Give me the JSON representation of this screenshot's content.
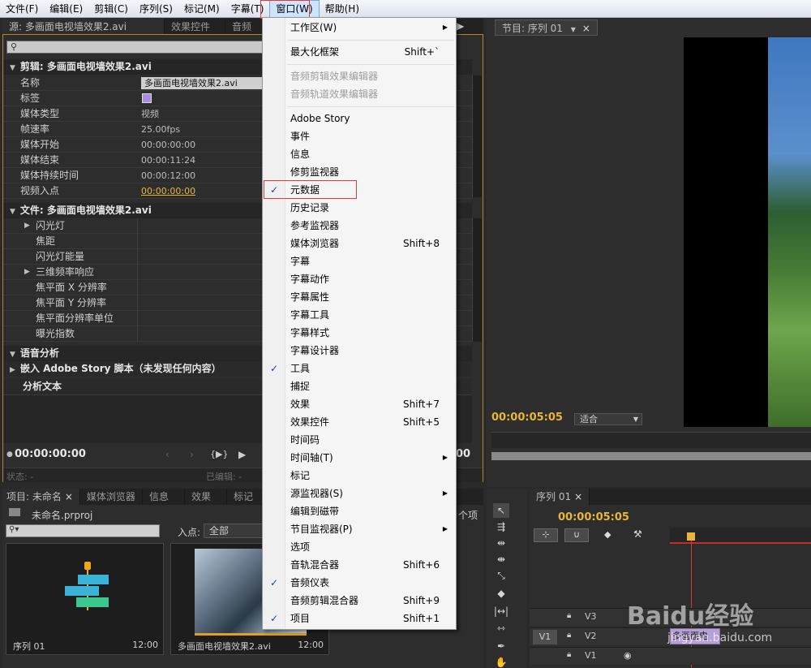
{
  "menubar": {
    "items": [
      "文件(F)",
      "编辑(E)",
      "剪辑(C)",
      "序列(S)",
      "标记(M)",
      "字幕(T)",
      "窗口(W)",
      "帮助(H)"
    ]
  },
  "meta_panel": {
    "tabs": [
      "源: 多画面电视墙效果2.avi",
      "效果控件",
      "音频"
    ],
    "clip_header": "剪辑: 多画面电视墙效果2.avi",
    "clip_rows": [
      {
        "k": "名称",
        "v": "多画面电视墙效果2.avi"
      },
      {
        "k": "标签",
        "v": ""
      },
      {
        "k": "媒体类型",
        "v": "视频"
      },
      {
        "k": "帧速率",
        "v": "25.00fps"
      },
      {
        "k": "媒体开始",
        "v": "00:00:00:00"
      },
      {
        "k": "媒体结束",
        "v": "00:00:11:24"
      },
      {
        "k": "媒体持续时间",
        "v": "00:00:12:00"
      },
      {
        "k": "视频入点",
        "v": "00:00:00:00"
      }
    ],
    "file_header": "文件: 多画面电视墙效果2.avi",
    "file_rows": [
      {
        "k": "闪光灯",
        "expand": true
      },
      {
        "k": "焦距",
        "expand": false
      },
      {
        "k": "闪光灯能量",
        "expand": false
      },
      {
        "k": "三维频率响应",
        "expand": true
      },
      {
        "k": "焦平面 X 分辨率",
        "expand": false
      },
      {
        "k": "焦平面 Y 分辨率",
        "expand": false
      },
      {
        "k": "焦平面分辨率单位",
        "expand": false
      },
      {
        "k": "曝光指数",
        "expand": false
      }
    ],
    "speech_header": "语音分析",
    "embed_label": "嵌入 Adobe Story 脚本（未发现任何内容）",
    "analysis_label": "分析文本",
    "timecode": "00:00:00:00",
    "timecode_right": "00",
    "status_label": "状态: -",
    "edited_label": "已编辑: -"
  },
  "menu": {
    "items": [
      {
        "label": "工作区(W)",
        "sc": "",
        "sub": true,
        "check": false,
        "disabled": false
      },
      {
        "sep": true
      },
      {
        "label": "最大化框架",
        "sc": "Shift+`",
        "sub": false,
        "check": false,
        "disabled": false
      },
      {
        "sep": true
      },
      {
        "label": "音频剪辑效果编辑器",
        "sc": "",
        "sub": false,
        "check": false,
        "disabled": true
      },
      {
        "label": "音频轨道效果编辑器",
        "sc": "",
        "sub": false,
        "check": false,
        "disabled": true
      },
      {
        "sep": true
      },
      {
        "label": "Adobe Story",
        "sc": "",
        "sub": false,
        "check": false,
        "disabled": false
      },
      {
        "label": "事件",
        "sc": "",
        "sub": false,
        "check": false,
        "disabled": false
      },
      {
        "label": "信息",
        "sc": "",
        "sub": false,
        "check": false,
        "disabled": false
      },
      {
        "label": "修剪监视器",
        "sc": "",
        "sub": false,
        "check": false,
        "disabled": false
      },
      {
        "label": "元数据",
        "sc": "",
        "sub": false,
        "check": true,
        "disabled": false
      },
      {
        "label": "历史记录",
        "sc": "",
        "sub": false,
        "check": false,
        "disabled": false
      },
      {
        "label": "参考监视器",
        "sc": "",
        "sub": false,
        "check": false,
        "disabled": false
      },
      {
        "label": "媒体浏览器",
        "sc": "Shift+8",
        "sub": false,
        "check": false,
        "disabled": false
      },
      {
        "label": "字幕",
        "sc": "",
        "sub": false,
        "check": false,
        "disabled": false
      },
      {
        "label": "字幕动作",
        "sc": "",
        "sub": false,
        "check": false,
        "disabled": false
      },
      {
        "label": "字幕属性",
        "sc": "",
        "sub": false,
        "check": false,
        "disabled": false
      },
      {
        "label": "字幕工具",
        "sc": "",
        "sub": false,
        "check": false,
        "disabled": false
      },
      {
        "label": "字幕样式",
        "sc": "",
        "sub": false,
        "check": false,
        "disabled": false
      },
      {
        "label": "字幕设计器",
        "sc": "",
        "sub": false,
        "check": false,
        "disabled": false
      },
      {
        "label": "工具",
        "sc": "",
        "sub": false,
        "check": true,
        "disabled": false
      },
      {
        "label": "捕捉",
        "sc": "",
        "sub": false,
        "check": false,
        "disabled": false
      },
      {
        "label": "效果",
        "sc": "Shift+7",
        "sub": false,
        "check": false,
        "disabled": false
      },
      {
        "label": "效果控件",
        "sc": "Shift+5",
        "sub": false,
        "check": false,
        "disabled": false
      },
      {
        "label": "时间码",
        "sc": "",
        "sub": false,
        "check": false,
        "disabled": false
      },
      {
        "label": "时间轴(T)",
        "sc": "",
        "sub": true,
        "check": false,
        "disabled": false
      },
      {
        "label": "标记",
        "sc": "",
        "sub": false,
        "check": false,
        "disabled": false
      },
      {
        "label": "源监视器(S)",
        "sc": "",
        "sub": true,
        "check": false,
        "disabled": false
      },
      {
        "label": "编辑到磁带",
        "sc": "",
        "sub": false,
        "check": false,
        "disabled": false
      },
      {
        "label": "节目监视器(P)",
        "sc": "",
        "sub": true,
        "check": false,
        "disabled": false
      },
      {
        "label": "选项",
        "sc": "",
        "sub": false,
        "check": false,
        "disabled": false
      },
      {
        "label": "音轨混合器",
        "sc": "Shift+6",
        "sub": false,
        "check": false,
        "disabled": false
      },
      {
        "label": "音频仪表",
        "sc": "",
        "sub": false,
        "check": true,
        "disabled": false
      },
      {
        "label": "音频剪辑混合器",
        "sc": "Shift+9",
        "sub": false,
        "check": false,
        "disabled": false
      },
      {
        "label": "项目",
        "sc": "Shift+1",
        "sub": false,
        "check": true,
        "disabled": false
      }
    ]
  },
  "program": {
    "tab": "节目: 序列 01",
    "timecode": "00:00:05:05",
    "fit": "适合"
  },
  "project": {
    "tabs": [
      "项目: 未命名",
      "媒体浏览器",
      "信息",
      "效果",
      "标记"
    ],
    "project_file": "未命名.prproj",
    "inpoint_label": "入点:",
    "inpoint_value": "全部",
    "items_count": "个项",
    "thumb1_name": "序列 01",
    "thumb1_dur": "12:00",
    "thumb2_name": "多画面电视墙效果2.avi",
    "thumb2_dur": "12:00"
  },
  "timeline": {
    "tab": "序列 01",
    "timecode": "00:00:05:05",
    "tracks": [
      "V3",
      "V2",
      "V1"
    ],
    "source_patch": "V1",
    "clip_label": "多画面电",
    "watermark": "Baidu经验",
    "watermark_url": "jingyan.baidu.com"
  }
}
